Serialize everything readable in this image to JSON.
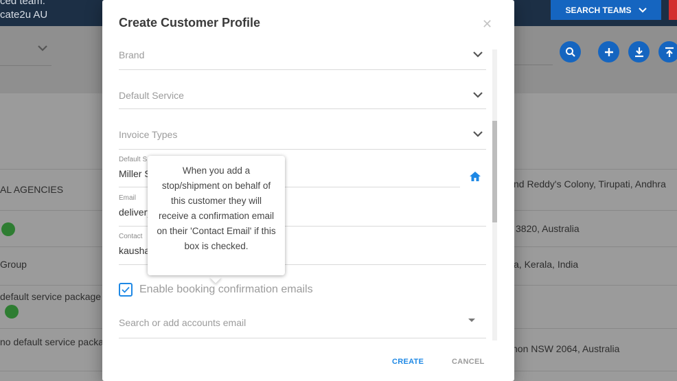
{
  "background": {
    "topbar": {
      "line1": "ced team:",
      "line2": "cate2u AU",
      "search_teams_label": "SEARCH TEAMS"
    },
    "rows": [
      {
        "left": "AL AGENCIES",
        "right": "nd Reddy's Colony, Tirupati, Andhra"
      },
      {
        "left": "",
        "right": "3820, Australia"
      },
      {
        "left": "Group",
        "right": "a, Kerala, India"
      },
      {
        "left": "default service package -",
        "right": ""
      },
      {
        "left": "no default service packag",
        "right": "non NSW 2064, Australia"
      }
    ]
  },
  "modal": {
    "title": "Create Customer Profile",
    "close_icon": "close-icon",
    "brand_label": "Brand",
    "default_service_label": "Default Service",
    "invoice_types_label": "Invoice Types",
    "default_site": {
      "label": "Default S",
      "value": "Miller S"
    },
    "email": {
      "label": "Email",
      "value": "delivery"
    },
    "contact_email": {
      "label": "Contact",
      "value": "kausha"
    },
    "checkbox_label": "Enable booking confirmation emails",
    "checkbox_checked": true,
    "accounts_placeholder": "Search or add accounts email",
    "create_label": "CREATE",
    "cancel_label": "CANCEL",
    "tooltip": "When you add a stop/shipment on behalf of this customer they will receive a confirmation email on their 'Contact Email' if this box is checked."
  },
  "colors": {
    "accent": "#1e88e5",
    "topbar": "#1c2f45",
    "button_blue": "#1565c0",
    "user_green": "#2e7d32"
  }
}
